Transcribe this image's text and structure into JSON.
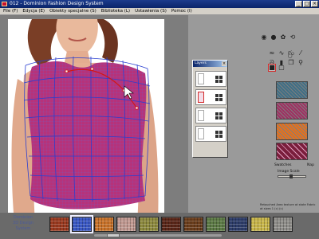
{
  "titlebar": {
    "title": "012 - Dominion Fashion Design System"
  },
  "menu": [
    "File (F)",
    "Edycja (E)",
    "Obiekty specjalne (S)",
    "Biblioteka (L)",
    "Ustawienia (S)",
    "Pomoc (I)"
  ],
  "tools": [
    {
      "icon": "globe-icon",
      "glyph": "◉"
    },
    {
      "icon": "sphere-icon",
      "glyph": "●"
    },
    {
      "icon": "flower-icon",
      "glyph": "✿"
    },
    {
      "icon": "rotate-icon",
      "glyph": "⟲"
    },
    {
      "icon": "zigzag-icon",
      "glyph": "≈"
    },
    {
      "icon": "wave-icon",
      "glyph": "∿"
    },
    {
      "icon": "spiral-icon",
      "glyph": "ꩺ"
    },
    {
      "icon": "wand-icon",
      "glyph": "⁄"
    },
    {
      "icon": "swirl-icon",
      "glyph": "ᘐ"
    },
    {
      "icon": "shade-icon",
      "glyph": "▮"
    },
    {
      "icon": "copy-icon",
      "glyph": "❐"
    },
    {
      "icon": "zoom-icon",
      "glyph": "⚲"
    },
    {
      "icon": "square-icon",
      "glyph": "■"
    },
    {
      "icon": "frame-icon",
      "glyph": "▢"
    }
  ],
  "swatches": [
    {
      "name": "teal-swatch",
      "color": "#3f6f86"
    },
    {
      "name": "burgundy-swatch",
      "color": "#a02f62"
    },
    {
      "name": "orange-swatch",
      "color": "#e8701a"
    },
    {
      "name": "checker-swatch",
      "color": "#7a1e3c"
    }
  ],
  "swatch_labels": {
    "left": "Swatches",
    "right": "Nap"
  },
  "image_scale_label": "Image Scale",
  "layers_panel": {
    "title": "Layers",
    "rows": [
      {
        "active": false
      },
      {
        "active": true
      },
      {
        "active": false
      },
      {
        "active": false
      }
    ]
  },
  "status_text": "Retouched Area texture at state Fabric at sizes 1 (c) (c)",
  "logo": {
    "line1": "Dominion",
    "line2": "3D Design",
    "line3": "System"
  },
  "fabrics": [
    {
      "name": "fabric-red-plaid",
      "color": "#9b3a20"
    },
    {
      "name": "fabric-blue-check",
      "color": "#3a58c4"
    },
    {
      "name": "fabric-orange-plaid",
      "color": "#c9732a"
    },
    {
      "name": "fabric-rose-knit",
      "color": "#c29a92"
    },
    {
      "name": "fabric-olive-check",
      "color": "#8d8a3e"
    },
    {
      "name": "fabric-maroon-check",
      "color": "#5a2618"
    },
    {
      "name": "fabric-brown-check",
      "color": "#6b3e1c"
    },
    {
      "name": "fabric-green-grid",
      "color": "#5c7a45"
    },
    {
      "name": "fabric-navy-check",
      "color": "#2e3d6a"
    },
    {
      "name": "fabric-yellow-tweed",
      "color": "#c8b64a"
    },
    {
      "name": "fabric-grey-tweed",
      "color": "#8f8e8a"
    }
  ]
}
